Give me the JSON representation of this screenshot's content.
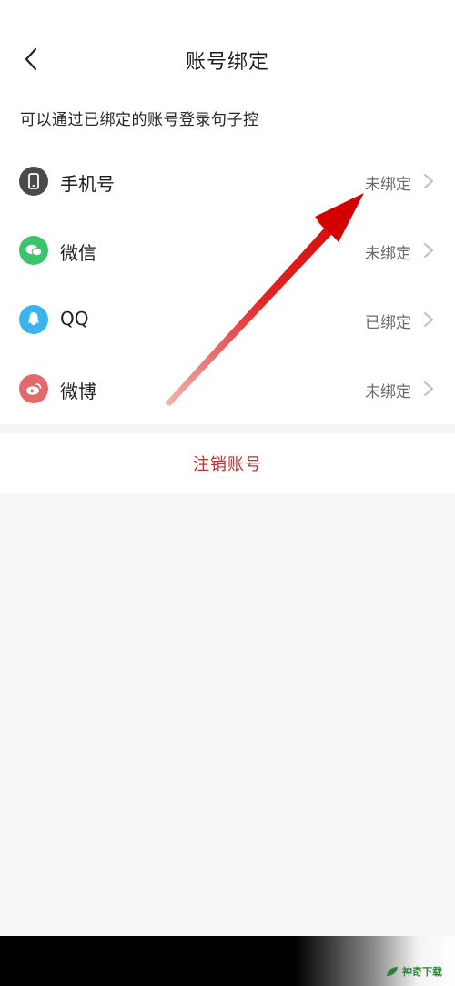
{
  "header": {
    "title": "账号绑定"
  },
  "subtitle": "可以通过已绑定的账号登录句子控",
  "accounts": [
    {
      "name": "手机号",
      "status": "未绑定",
      "icon": "phone-icon",
      "color": "#4a4a4a"
    },
    {
      "name": "微信",
      "status": "未绑定",
      "icon": "wechat-icon",
      "color": "#3cc46a"
    },
    {
      "name": "QQ",
      "status": "已绑定",
      "icon": "qq-icon",
      "color": "#3bb4ee"
    },
    {
      "name": "微博",
      "status": "未绑定",
      "icon": "weibo-icon",
      "color": "#e36a6a"
    }
  ],
  "logout_label": "注销账号",
  "colors": {
    "accent_red": "#c0302a",
    "background": "#f6f6f6"
  },
  "watermark": "神奇下载"
}
